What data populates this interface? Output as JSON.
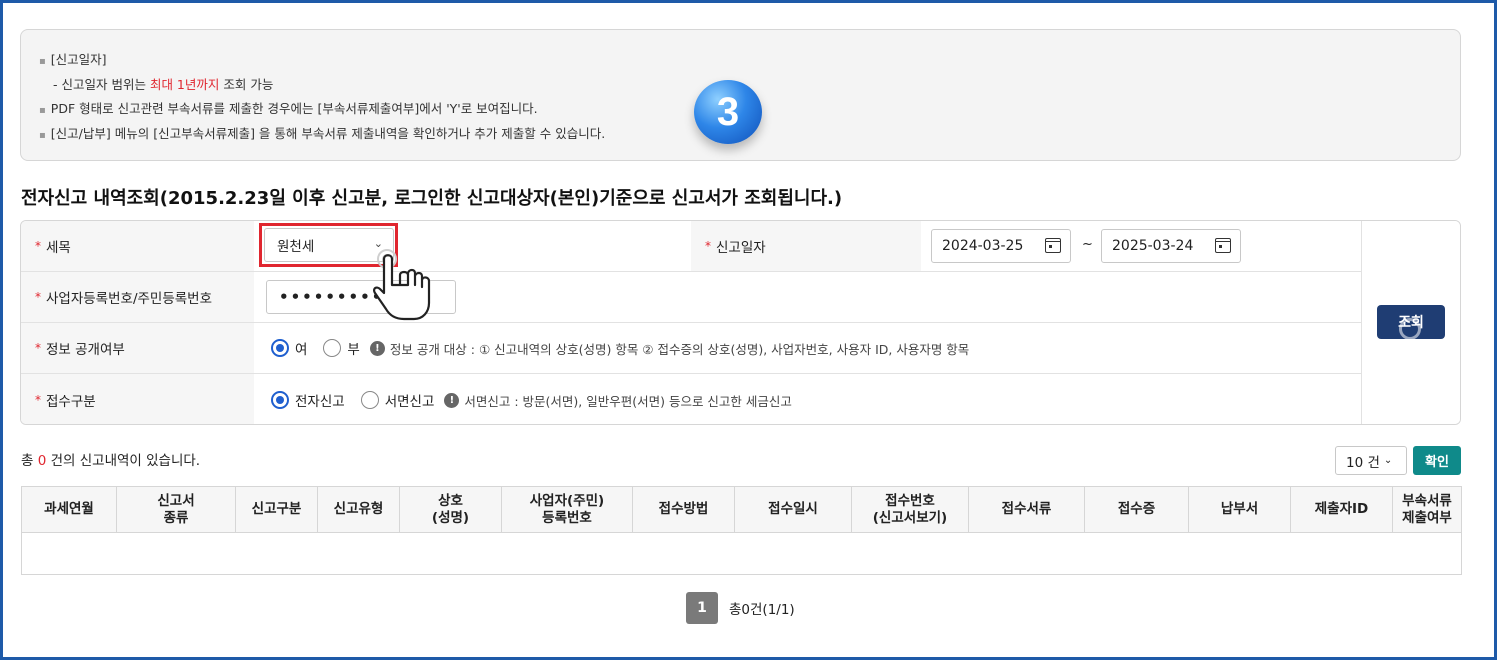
{
  "notice": {
    "item1_title": "[신고일자]",
    "item1_sub_prefix": "- 신고일자 범위는 ",
    "item1_sub_highlight": "최대 1년까지",
    "item1_sub_suffix": " 조회 가능",
    "item2": "PDF 형태로 신고관련 부속서류를 제출한 경우에는 [부속서류제출여부]에서 'Y'로 보여집니다.",
    "item3": "[신고/납부] 메뉴의 [신고부속서류제출] 을 통해 부속서류 제출내역을 확인하거나 추가 제출할 수 있습니다."
  },
  "step_badge": "3",
  "page_title": "전자신고 내역조회(2015.2.23일 이후 신고분, 로그인한  신고대상자(본인)기준으로  신고서가 조회됩니다.)",
  "form": {
    "required_mark": "*",
    "tax_item_label": "세목",
    "tax_item_value": "원천세",
    "report_date_label": "신고일자",
    "date_from": "2024-03-25",
    "date_sep": "~",
    "date_to": "2025-03-24",
    "biz_no_label": "사업자등록번호/주민등록번호",
    "biz_no_value": "••••••••••",
    "disclosure_label": "정보 공개여부",
    "disclosure_yes": "여",
    "disclosure_no": "부",
    "disclosure_info": "정보 공개 대상 : ① 신고내역의 상호(성명) 항목 ② 접수증의 상호(성명), 사업자번호, 사용자 ID, 사용자명 항목",
    "receipt_type_label": "접수구분",
    "receipt_electronic": "전자신고",
    "receipt_paper": "서면신고",
    "receipt_info": "서면신고 : 방문(서면), 일반우편(서면) 등으로 신고한 세금신고",
    "search_button": "조회"
  },
  "results": {
    "count_prefix": "총 ",
    "count_value": "0",
    "count_suffix": " 건의 신고내역이 있습니다.",
    "page_size": "10 건",
    "confirm_button": "확인",
    "columns": [
      "과세연월",
      "신고서\n종류",
      "신고구분",
      "신고유형",
      "상호\n(성명)",
      "사업자(주민)\n등록번호",
      "접수방법",
      "접수일시",
      "접수번호\n(신고서보기)",
      "접수서류",
      "접수증",
      "납부서",
      "제출자ID",
      "부속서류\n제출여부"
    ]
  },
  "pager": {
    "current_page": "1",
    "total_text": "총0건(1/1)"
  },
  "colors": {
    "accent_red": "#e0262f",
    "search_button": "#1f3d73",
    "confirm_button": "#0f8a8a",
    "frame_border": "#1e5aa8"
  }
}
